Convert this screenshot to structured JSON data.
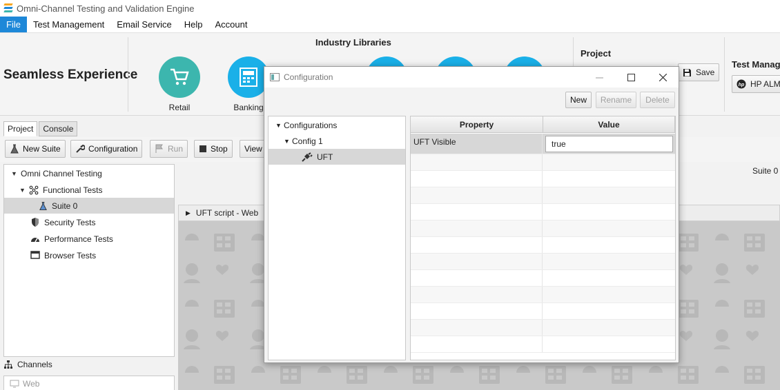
{
  "window": {
    "title": "Omni-Channel Testing and Validation Engine"
  },
  "menu": [
    {
      "label": "File",
      "active": true
    },
    {
      "label": "Test Management"
    },
    {
      "label": "Email Service"
    },
    {
      "label": "Help"
    },
    {
      "label": "Account"
    }
  ],
  "ribbon": {
    "brand": "Seamless Experience",
    "libraries_title": "Industry Libraries",
    "libraries": [
      {
        "label": "Retail",
        "color": "#3cb6ae",
        "icon": "cart-icon"
      },
      {
        "label": "Banking",
        "color": "#1ab0e8",
        "icon": "atm-icon"
      },
      {
        "label": "",
        "color": "#1ab0e8"
      },
      {
        "label": "",
        "color": "#1ab0e8"
      },
      {
        "label": "",
        "color": "#1ab0e8"
      }
    ],
    "project_title": "Project",
    "save_label": "Save",
    "test_mgmt_title": "Test Manag",
    "hp_alm_label": "HP ALM"
  },
  "tabs": [
    {
      "label": "Project",
      "selected": true
    },
    {
      "label": "Console"
    }
  ],
  "toolbar": {
    "new_suite": "New Suite",
    "configuration": "Configuration",
    "run": "Run",
    "stop": "Stop",
    "view": "View"
  },
  "tree": {
    "root": "Omni Channel Testing",
    "functional": "Functional Tests",
    "suite": "Suite 0",
    "security": "Security Tests",
    "performance": "Performance Tests",
    "browser": "Browser Tests"
  },
  "channels": {
    "label": "Channels",
    "web": "Web"
  },
  "main": {
    "suite_label": "Suite 0",
    "uft_header": "UFT script - Web"
  },
  "dialog": {
    "title": "Configuration",
    "buttons": {
      "new": "New",
      "rename": "Rename",
      "delete": "Delete"
    },
    "tree": {
      "root": "Configurations",
      "config": "Config 1",
      "leaf": "UFT"
    },
    "table": {
      "headers": [
        "Property",
        "Value"
      ],
      "rows": [
        {
          "property": "UFT Visible",
          "value": "true"
        }
      ]
    }
  }
}
